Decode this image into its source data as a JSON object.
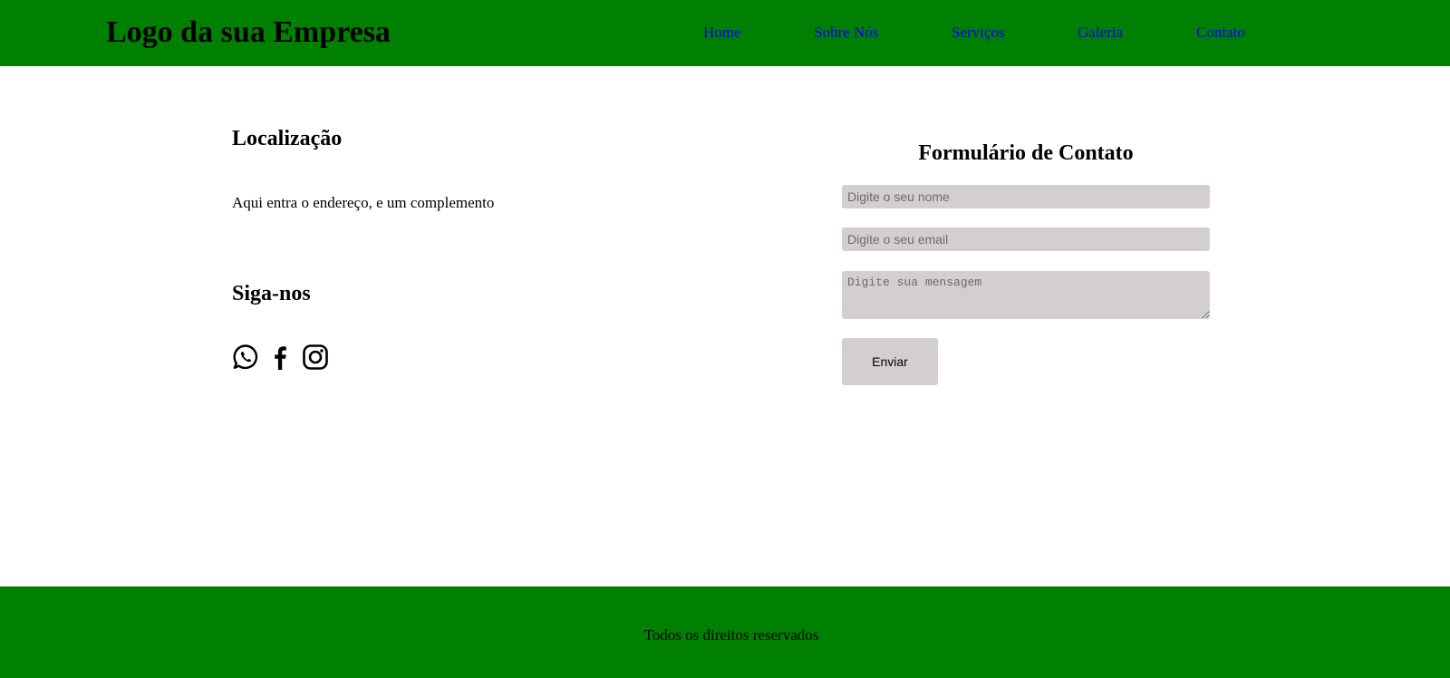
{
  "header": {
    "logo": "Logo da sua Empresa",
    "nav": [
      "Home",
      "Sobre Nós",
      "Serviços",
      "Galeria",
      "Contato"
    ]
  },
  "location": {
    "title": "Localização",
    "address": "Aqui entra o endereço, e um complemento"
  },
  "social": {
    "title": "Siga-nos",
    "icons": [
      "whatsapp-icon",
      "facebook-icon",
      "instagram-icon"
    ]
  },
  "contact_form": {
    "title": "Formulário de Contato",
    "name_placeholder": "Digite o seu nome",
    "email_placeholder": "Digite o seu email",
    "message_placeholder": "Digite sua mensagem",
    "submit_label": "Enviar"
  },
  "footer": {
    "text": "Todos os direitos reservados"
  },
  "colors": {
    "header_bg": "#008000",
    "footer_bg": "#008000",
    "link": "#0000ee",
    "field_bg": "#d3cfcf"
  }
}
